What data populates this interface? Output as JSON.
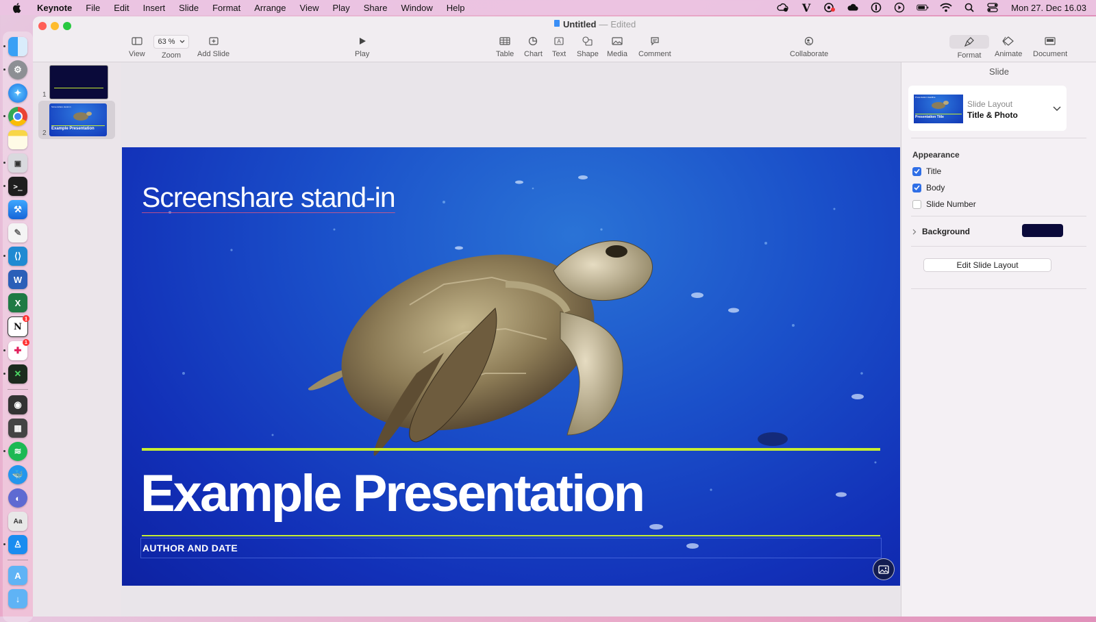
{
  "menubar": {
    "app_name": "Keynote",
    "items": [
      "File",
      "Edit",
      "Insert",
      "Slide",
      "Format",
      "Arrange",
      "View",
      "Play",
      "Share",
      "Window",
      "Help"
    ],
    "clock": "Mon 27. Dec  16.03",
    "status_icons": [
      "cloud-sync-icon",
      "vivaldi-icon",
      "chrome-ext-icon",
      "icloud-icon",
      "onepassword-icon",
      "play-circle-icon",
      "battery-icon",
      "wifi-icon",
      "search-icon",
      "control-center-icon"
    ]
  },
  "window": {
    "title": "Untitled",
    "title_suffix": "Edited",
    "separator": "—"
  },
  "toolbar": {
    "view": "View",
    "zoom": "Zoom",
    "zoom_value": "63 %",
    "add_slide": "Add Slide",
    "play": "Play",
    "table": "Table",
    "chart": "Chart",
    "text": "Text",
    "shape": "Shape",
    "media": "Media",
    "comment": "Comment",
    "collaborate": "Collaborate",
    "format": "Format",
    "animate": "Animate",
    "document": "Document"
  },
  "navigator": {
    "slides": [
      {
        "number": "1",
        "selected": false
      },
      {
        "number": "2",
        "selected": true,
        "thumb_title": "Example Presentation",
        "thumb_sub": "Screenshare stand-in"
      }
    ]
  },
  "slide": {
    "subtitle": "Screenshare stand-in",
    "title": "Example Presentation",
    "author": "AUTHOR AND DATE",
    "accent_color": "#c7ee32"
  },
  "inspector": {
    "header": "Slide",
    "layout_label": "Slide Layout",
    "layout_value": "Title & Photo",
    "layout_thumb_top": "Presentation Headline",
    "layout_thumb_title": "Presentation Title",
    "appearance": "Appearance",
    "checks": [
      {
        "label": "Title",
        "checked": true
      },
      {
        "label": "Body",
        "checked": true
      },
      {
        "label": "Slide Number",
        "checked": false
      }
    ],
    "background": "Background",
    "background_color": "#0a0a3a",
    "edit_layout": "Edit Slide Layout"
  }
}
